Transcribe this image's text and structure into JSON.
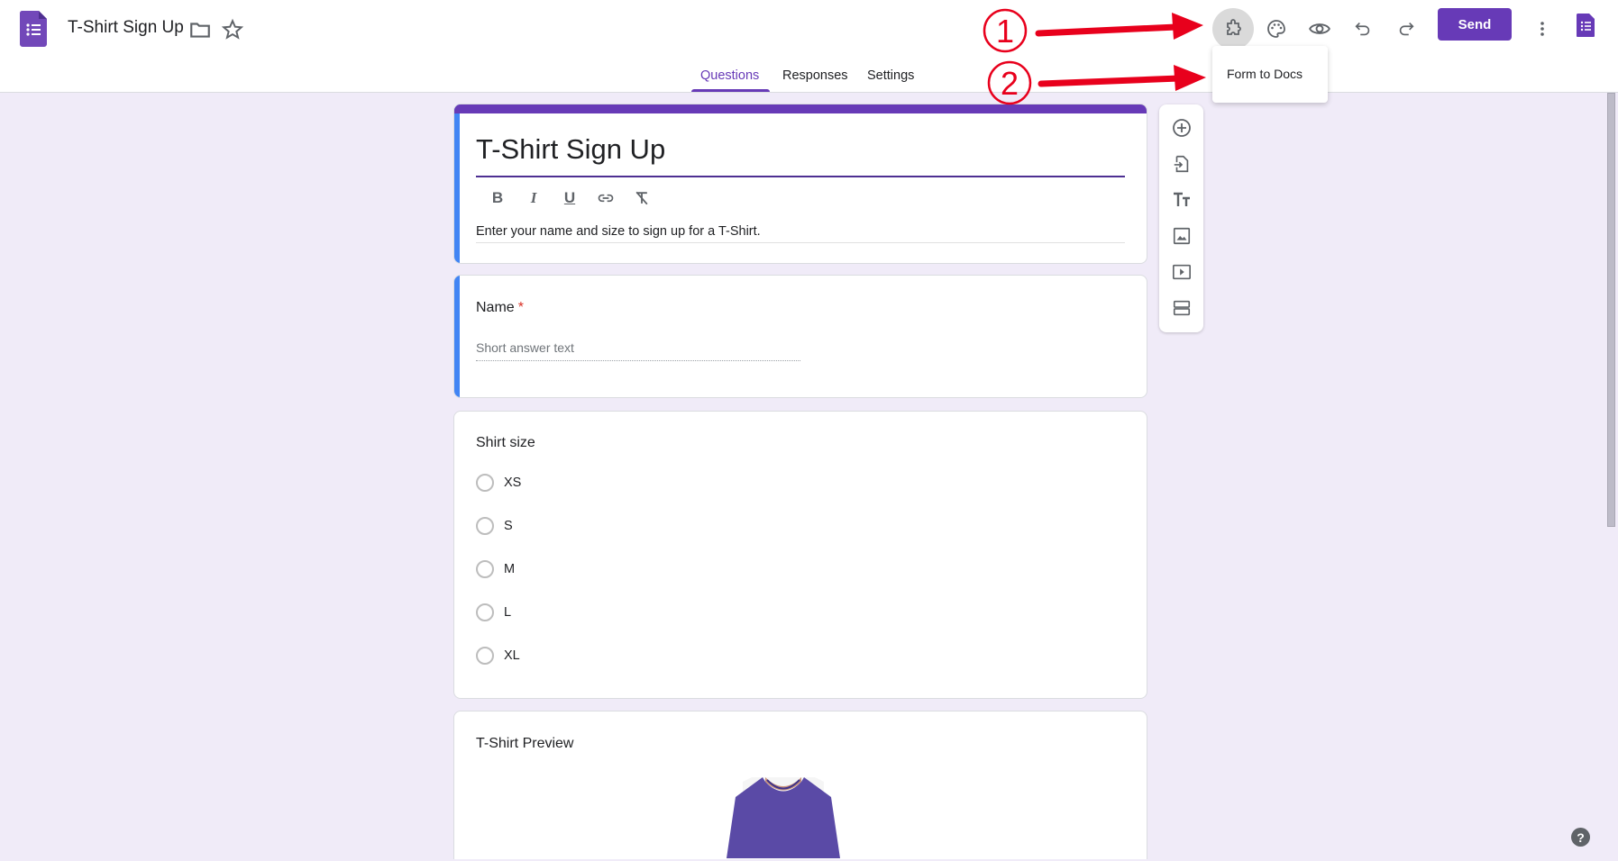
{
  "header": {
    "doc_title": "T-Shirt Sign Up",
    "send_label": "Send",
    "icons": [
      "forms-logo-icon",
      "folder-icon",
      "star-icon",
      "puzzle-addon-icon",
      "palette-icon",
      "eye-preview-icon",
      "undo-icon",
      "redo-icon",
      "more-vert-icon",
      "forms-sheets-icon"
    ]
  },
  "tabs": [
    {
      "label": "Questions",
      "active": true
    },
    {
      "label": "Responses",
      "active": false
    },
    {
      "label": "Settings",
      "active": false
    }
  ],
  "addon_menu": {
    "items": [
      {
        "label": "Form to Docs"
      }
    ]
  },
  "annotations": [
    {
      "number": "1",
      "target": "add-ons button"
    },
    {
      "number": "2",
      "target": "Form to Docs menu item"
    }
  ],
  "form": {
    "title": "T-Shirt Sign Up",
    "description": "Enter your name and size to sign up for a T-Shirt.",
    "format_buttons": [
      "B",
      "I",
      "U",
      "link",
      "clear-format"
    ]
  },
  "questions": [
    {
      "title": "Name",
      "required": true,
      "required_mark": "*",
      "placeholder": "Short answer text"
    },
    {
      "title": "Shirt size",
      "options": [
        "XS",
        "S",
        "M",
        "L",
        "XL"
      ]
    },
    {
      "title": "T-Shirt Preview"
    }
  ],
  "side_toolbar": [
    "add-question-icon",
    "import-questions-icon",
    "add-title-icon",
    "add-image-icon",
    "add-video-icon",
    "add-section-icon"
  ],
  "help": {
    "label": "?"
  },
  "colors": {
    "accent": "#673ab7",
    "selected": "#4285f4",
    "background": "#f0ebf8",
    "annotation": "#e8001c"
  }
}
